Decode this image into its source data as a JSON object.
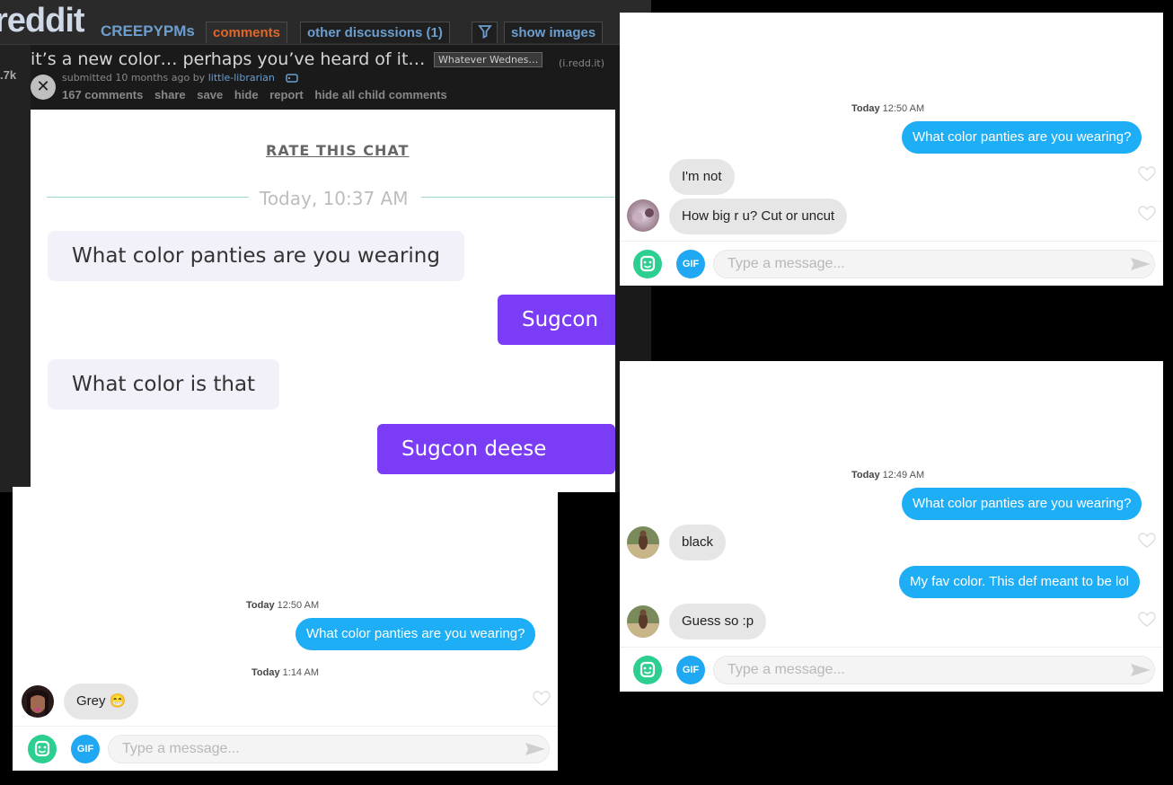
{
  "reddit": {
    "logo": "reddit",
    "subreddit": "CREEPYPMs",
    "tabs": [
      "comments",
      "other discussions (1)",
      "show images"
    ],
    "score": ".7k",
    "post_title": "it’s a new color… perhaps you’ve heard of it…",
    "flair": "Whatever Wednes…",
    "domain": "(i.redd.it)",
    "tagline_prefix": "submitted 10 months ago by",
    "author": "little-librarian",
    "actions": [
      "167 comments",
      "share",
      "save",
      "hide",
      "report",
      "hide all child comments"
    ],
    "chat": {
      "rate_label": "RATE THIS CHAT",
      "date": "Today, 10:37 AM",
      "messages": [
        {
          "dir": "received",
          "text": "What color panties are you wearing"
        },
        {
          "dir": "sent",
          "text": "Sugcon"
        },
        {
          "dir": "received",
          "text": "What color is that"
        },
        {
          "dir": "sent",
          "text": "Sugcon deese nuts"
        }
      ]
    }
  },
  "chat_top_right": {
    "timestamp_day": "Today",
    "timestamp_time": "12:50 AM",
    "messages": [
      {
        "dir": "sent",
        "text": "What color panties are you wearing?"
      },
      {
        "dir": "received",
        "text": "I'm not"
      },
      {
        "dir": "received",
        "text": "How big r u? Cut or uncut"
      }
    ],
    "input_placeholder": "Type a message...",
    "gif_label": "GIF"
  },
  "chat_bottom_right": {
    "timestamp_day": "Today",
    "timestamp_time": "12:49 AM",
    "messages": [
      {
        "dir": "sent",
        "text": "What color panties are you wearing?"
      },
      {
        "dir": "received",
        "text": "black"
      },
      {
        "dir": "sent",
        "text": "My fav color. This def meant to be lol"
      },
      {
        "dir": "received",
        "text": "Guess so :p"
      }
    ],
    "input_placeholder": "Type a message...",
    "gif_label": "GIF"
  },
  "chat_bottom_left": {
    "timestamp1_day": "Today",
    "timestamp1_time": "12:50 AM",
    "timestamp2_day": "Today",
    "timestamp2_time": "1:14 AM",
    "messages": [
      {
        "dir": "sent",
        "text": "What color panties are you wearing?"
      },
      {
        "dir": "received",
        "text": "Grey 😁"
      }
    ],
    "input_placeholder": "Type a message...",
    "gif_label": "GIF"
  },
  "colors": {
    "sent_bubble": "#1eaef6",
    "received_bubble": "#e6e6e6",
    "reddit_sent_bubble": "#7a3cf5",
    "reddit_received_bubble": "#f2f0f8",
    "comments_tab": "#e0672a"
  },
  "icons": [
    "close-icon",
    "filter-icon",
    "tag-icon",
    "heart-icon",
    "emoji-icon",
    "send-icon",
    "avatar"
  ]
}
